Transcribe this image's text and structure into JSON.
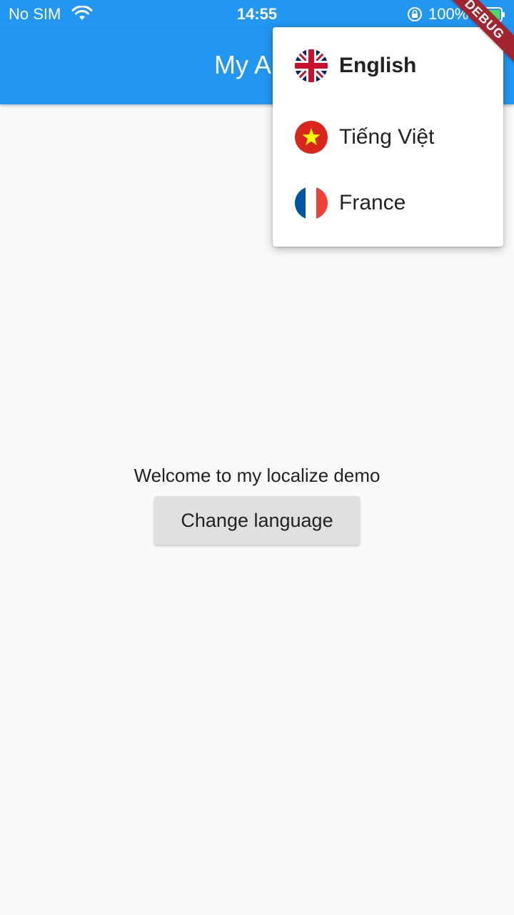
{
  "status_bar": {
    "carrier": "No SIM",
    "time": "14:55",
    "battery_percent": "100%",
    "icons": [
      "wifi-icon",
      "orientation-lock-icon",
      "battery-charging-icon"
    ]
  },
  "app_bar": {
    "title": "My App",
    "background_color": "#2196f3"
  },
  "debug_banner": "DEBUG",
  "language_menu": {
    "items": [
      {
        "label": "English",
        "flag": "uk-flag-icon",
        "selected": true
      },
      {
        "label": "Tiếng Việt",
        "flag": "vietnam-flag-icon",
        "selected": false
      },
      {
        "label": "France",
        "flag": "france-flag-icon",
        "selected": false
      }
    ]
  },
  "body": {
    "welcome_text": "Welcome to my localize demo",
    "change_language_button": "Change language"
  }
}
